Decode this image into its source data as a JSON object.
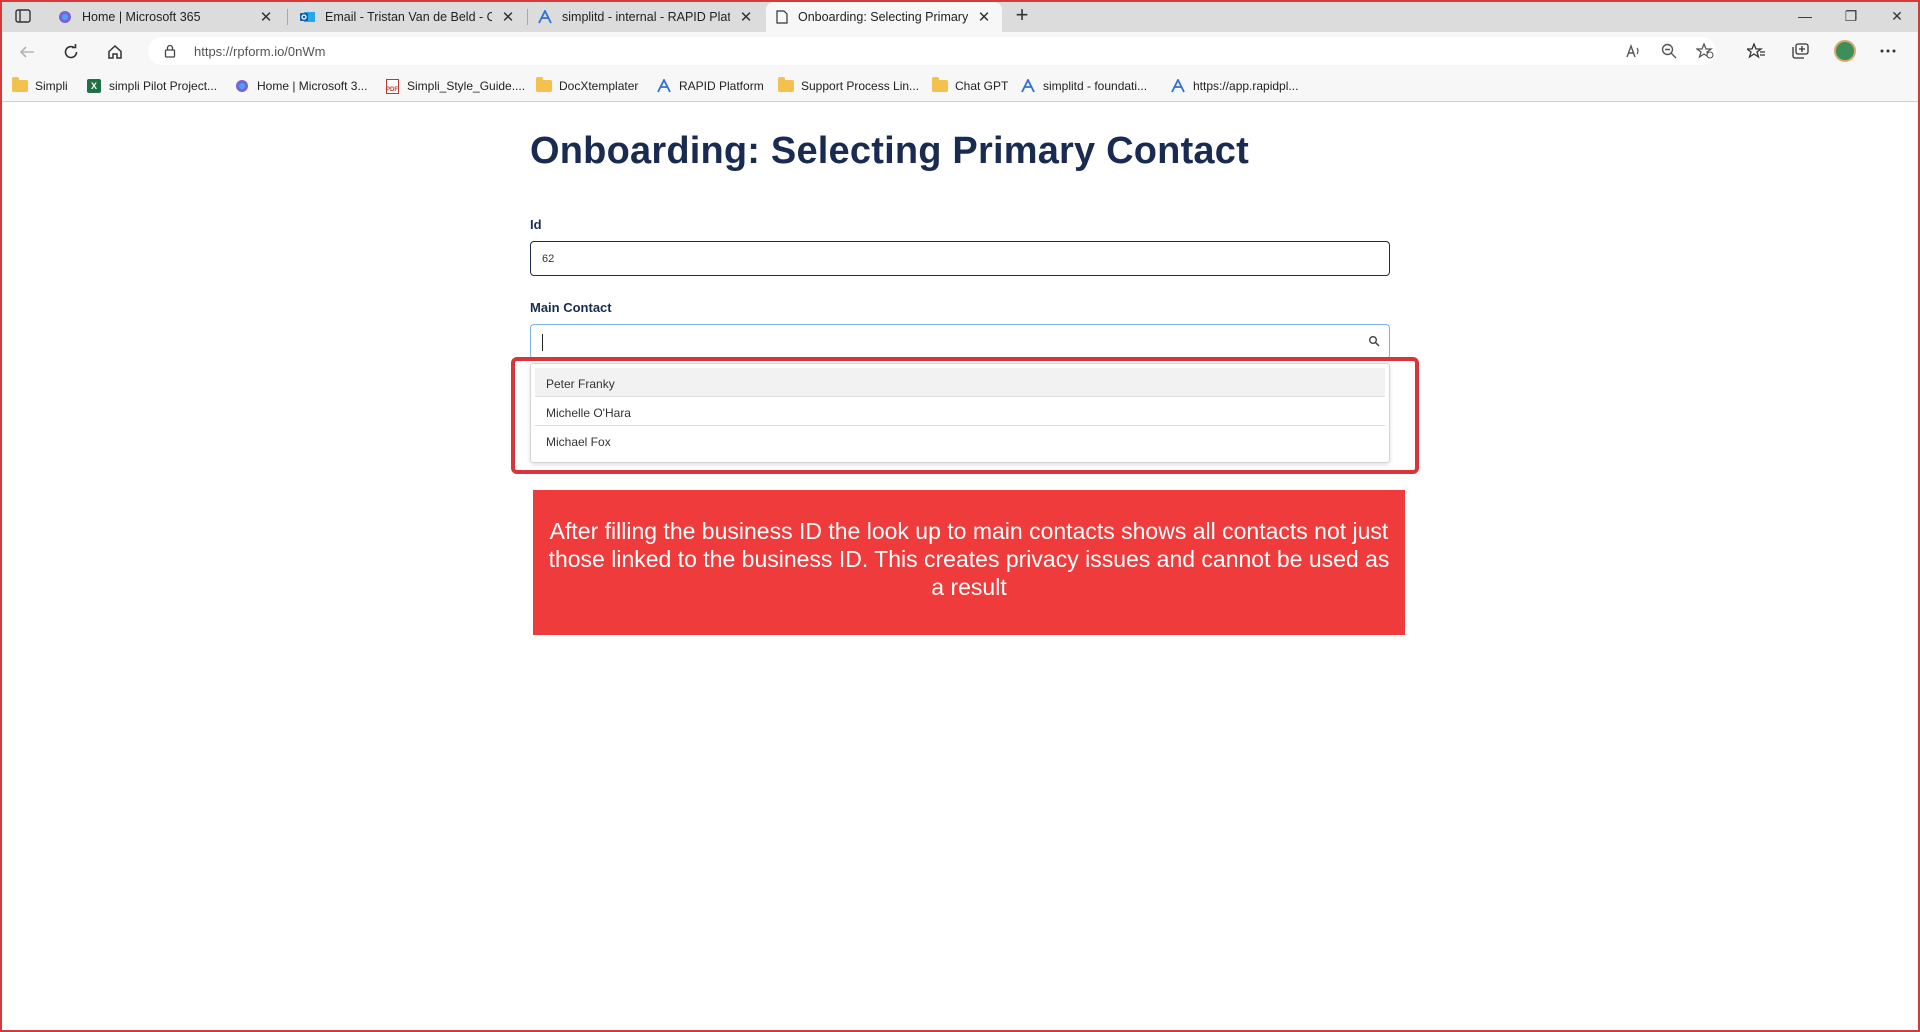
{
  "browser": {
    "tabs": [
      {
        "title": "Home | Microsoft 365",
        "icon": "microsoft-365-icon",
        "active": false
      },
      {
        "title": "Email - Tristan Van de Beld - Outlook",
        "icon": "outlook-icon",
        "active": false
      },
      {
        "title": "simplitd - internal - RAPID Platform",
        "icon": "rapid-icon",
        "active": false
      },
      {
        "title": "Onboarding: Selecting Primary Contact",
        "icon": "page-icon",
        "active": true
      }
    ],
    "new_tab_glyph": "+",
    "window_controls": {
      "minimize": "—",
      "restore": "❐",
      "close": "✕"
    },
    "url": "https://rpform.io/0nWm",
    "bookmarks": [
      {
        "label": "Simpli",
        "icon": "folder-icon"
      },
      {
        "label": "simpli Pilot Project...",
        "icon": "excel-icon"
      },
      {
        "label": "Home | Microsoft 3...",
        "icon": "microsoft-365-icon"
      },
      {
        "label": "Simpli_Style_Guide....",
        "icon": "pdf-icon"
      },
      {
        "label": "DocXtemplater",
        "icon": "folder-icon"
      },
      {
        "label": "RAPID Platform",
        "icon": "rapid-icon"
      },
      {
        "label": "Support Process Lin...",
        "icon": "folder-icon"
      },
      {
        "label": "Chat GPT",
        "icon": "folder-icon"
      },
      {
        "label": "simplitd - foundati...",
        "icon": "rapid-icon"
      },
      {
        "label": "https://app.rapidpl...",
        "icon": "rapid-icon"
      }
    ]
  },
  "form": {
    "title": "Onboarding: Selecting Primary Contact",
    "id_label": "Id",
    "id_value": "62",
    "main_contact_label": "Main Contact",
    "main_contact_value": "",
    "options": [
      "Peter Franky",
      "Michelle O'Hara",
      "Michael Fox"
    ]
  },
  "annotation": {
    "text": "After filling the business ID the look up to main contacts shows all contacts not just those linked to the business ID. This creates privacy issues and cannot be used as a result"
  },
  "colors": {
    "accent": "#1a2b52",
    "annotation": "#ef3b3b",
    "highlight_border": "#d9343a"
  }
}
